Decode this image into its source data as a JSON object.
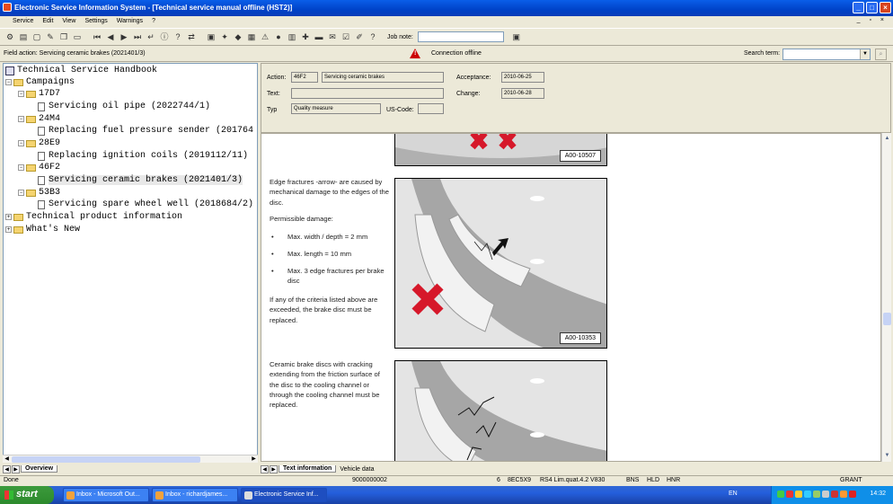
{
  "window": {
    "title": "Electronic Service Information System - [Technical service manual offline (HST2)]"
  },
  "menu": [
    "Service",
    "Edit",
    "View",
    "Settings",
    "Warnings",
    "?"
  ],
  "toolbar": {
    "job_note_label": "Job note:",
    "job_note_value": ""
  },
  "field_action": "Field action: Servicing ceramic brakes (2021401/3)",
  "connection": {
    "text": "Connection offline",
    "icon": "warning-icon"
  },
  "search": {
    "label": "Search term:",
    "value": ""
  },
  "tree": {
    "root": "Technical Service Handbook",
    "campaigns": "Campaigns",
    "g1": "17D7",
    "g1_item": "Servicing oil pipe (2022744/1)",
    "g2": "24M4",
    "g2_item": "Replacing fuel pressure sender (201764",
    "g3": "28E9",
    "g3_item": "Replacing ignition coils (2019112/11)",
    "g4": "46F2",
    "g4_item": "Servicing ceramic brakes (2021401/3)",
    "g5": "53B3",
    "g5_item": "Servicing spare wheel well (2018684/2)",
    "product": "Technical product information",
    "whatsnew": "What's New"
  },
  "left_tabs": {
    "overview": "Overview"
  },
  "detail": {
    "action_label": "Action:",
    "action_code": "46F2",
    "action_desc": "Servicing ceramic brakes",
    "acceptance_label": "Acceptance:",
    "acceptance_value": "2010-06-25",
    "text_label": "Text:",
    "text_value": "",
    "change_label": "Change:",
    "change_value": "2010-06-28",
    "type_label": "Typ",
    "type_value": "Quality measure",
    "uscode_label": "US-Code:",
    "uscode_value": ""
  },
  "document": {
    "fig1_label": "A00-10507",
    "para1": "Edge fractures -arrow- are caused by mechanical damage to the edges of the disc.",
    "para2": "Permissible damage:",
    "bullets": [
      "Max. width / depth = 2 mm",
      "Max. length = 10 mm",
      "Max. 3 edge fractures per brake disc"
    ],
    "para3": "If any of the criteria listed above are exceeded, the brake disc must be replaced.",
    "fig2_label": "A00-10353",
    "para4": "Ceramic brake discs with cracking extending from the friction surface of the disc to the cooling channel or through the cooling channel must be replaced."
  },
  "right_tabs": {
    "text_info": "Text information",
    "vehicle_data": "Vehicle data"
  },
  "statusbar": {
    "done": "Done",
    "vin": "9000000002",
    "n": "6",
    "model": "8EC5X9",
    "desc": "RS4 Lim.quat.4.2 V830",
    "f1": "BNS",
    "f2": "HLD",
    "f3": "HNR",
    "user": "GRANT"
  },
  "taskbar": {
    "start": "start",
    "tasks": [
      "Inbox - Microsoft Out...",
      "Inbox - richardjames...",
      "Electronic Service Inf..."
    ],
    "lang": "EN",
    "clock": "14:32"
  },
  "colors": {
    "title_blue": "#0a5ee8",
    "warn_red": "#cc0000",
    "cross_red": "#d6182a",
    "taskbar": "#245edb"
  }
}
